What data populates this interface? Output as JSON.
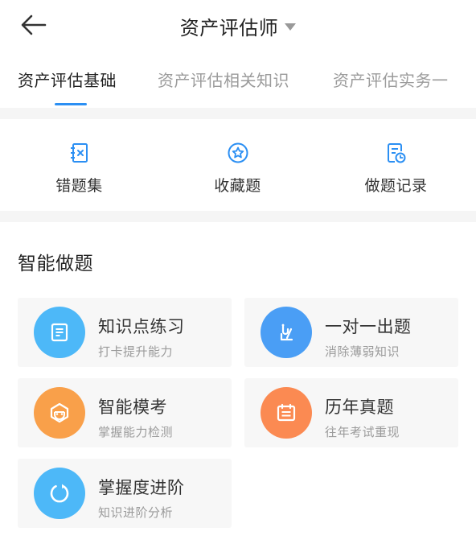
{
  "header": {
    "title": "资产评估师",
    "back_icon": "arrow-left-icon",
    "dropdown_icon": "caret-down-icon"
  },
  "tabs": [
    {
      "label": "资产评估基础",
      "active": true
    },
    {
      "label": "资产评估相关知识",
      "active": false
    },
    {
      "label": "资产评估实务一",
      "active": false
    }
  ],
  "quick_actions": [
    {
      "label": "错题集",
      "icon": "wrong-book-icon"
    },
    {
      "label": "收藏题",
      "icon": "star-icon"
    },
    {
      "label": "做题记录",
      "icon": "record-icon"
    }
  ],
  "section": {
    "title": "智能做题",
    "cards": [
      {
        "title": "知识点练习",
        "subtitle": "打卡提升能力",
        "icon": "document-icon",
        "color": "#4db8f8"
      },
      {
        "title": "一对一出题",
        "subtitle": "消除薄弱知识",
        "icon": "pen-icon",
        "color": "#4a9ef5"
      },
      {
        "title": "智能模考",
        "subtitle": "掌握能力检测",
        "icon": "robot-face-icon",
        "color": "#f9a04a"
      },
      {
        "title": "历年真题",
        "subtitle": "往年考试重现",
        "icon": "calendar-icon",
        "color": "#fb8a52"
      },
      {
        "title": "掌握度进阶",
        "subtitle": "知识进阶分析",
        "icon": "progress-ring-icon",
        "color": "#4db8f8"
      }
    ]
  },
  "colors": {
    "accent": "#2b8ff3",
    "tab_inactive": "#9b9b9b",
    "band": "#f5f5f5"
  }
}
